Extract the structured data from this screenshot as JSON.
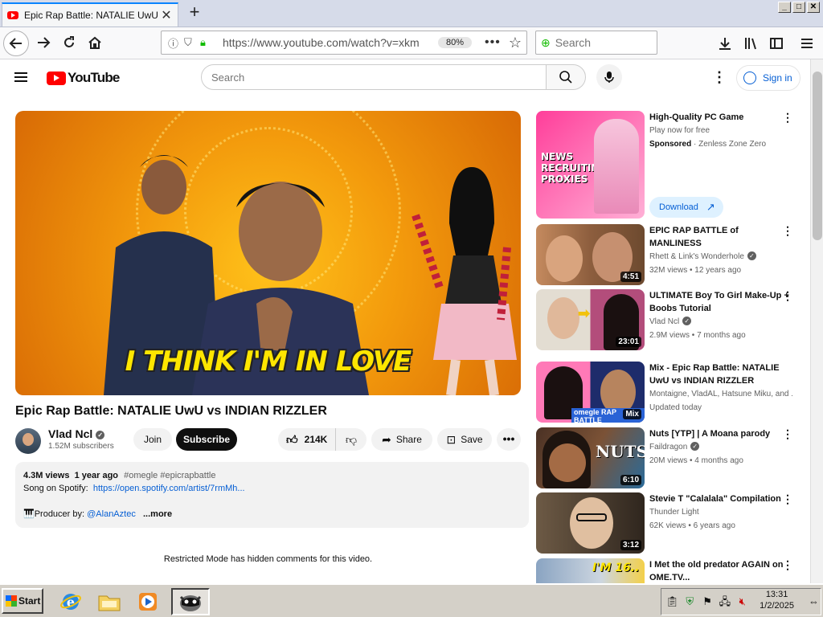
{
  "browser": {
    "tab_title": "Epic Rap Battle: NATALIE UwU vs INDIAN RIZZLER",
    "tab_close": "✕",
    "new_tab": "+",
    "url": "https://www.youtube.com/watch?v=xkm",
    "zoom": "80%",
    "search_placeholder": "Search",
    "window_buttons": [
      "_",
      "□",
      "✕"
    ]
  },
  "youtube": {
    "logo_text": "YouTube",
    "search_placeholder": "Search",
    "sign_in": "Sign in"
  },
  "video": {
    "caption": "I THINK I'M IN LOVE",
    "title": "Epic Rap Battle: NATALIE UwU vs INDIAN RIZZLER",
    "channel": "Vlad Ncl",
    "subscribers": "1.52M subscribers",
    "join": "Join",
    "subscribe": "Subscribe",
    "likes": "214K",
    "share": "Share",
    "save": "Save",
    "views": "4.3M views",
    "age": "1 year ago",
    "tags": "#omegle #epicrapbattle",
    "spotify_label": "Song on Spotify:",
    "spotify_link": "https://open.spotify.com/artist/7rmMh...",
    "producer_label": "🎹Producer by:",
    "producer_link": "@AlanAztec",
    "more": "...more",
    "restricted": "Restricted Mode has hidden comments for this video."
  },
  "sidebar": [
    {
      "title": "High-Quality PC Game",
      "line1": "Play now for free",
      "sponsored": "Sponsored",
      "line2": "· Zenless Zone Zero",
      "download": "Download",
      "thumb_text": "NEWS RECRUITING PROXIES",
      "colors": [
        "#ff3e9a",
        "#f8b6d8"
      ]
    },
    {
      "title": "EPIC RAP BATTLE of MANLINESS",
      "channel": "Rhett & Link's Wonderhole",
      "stats": "32M views • 12 years ago",
      "duration": "4:51",
      "colors": [
        "#c48a5e",
        "#6d4a2f"
      ]
    },
    {
      "title": "ULTIMATE Boy To Girl Make-Up + Boobs Tutorial",
      "channel": "Vlad Ncl",
      "stats": "2.9M views • 7 months ago",
      "duration": "23:01",
      "colors": [
        "#d8d2c8",
        "#b34d7b"
      ]
    },
    {
      "title": "Mix - Epic Rap Battle: NATALIE UwU vs INDIAN RIZZLER",
      "channel": "Montaigne, VladAL, Hatsune Miku, and ...",
      "stats": "Updated today",
      "badge": "Mix",
      "thumb_text": "omegle RAP BATTLE",
      "colors": [
        "#ff79b7",
        "#1e2c6b"
      ]
    },
    {
      "title": "Nuts [YTP] | A Moana parody",
      "channel": "Faildragon",
      "stats": "20M views • 4 months ago",
      "duration": "6:10",
      "thumb_text": "NUTS",
      "colors": [
        "#4a3124",
        "#2a6b9a"
      ]
    },
    {
      "title": "Stevie T \"Calalala\" Compilation",
      "channel": "Thunder Light",
      "stats": "62K views • 6 years ago",
      "duration": "3:12",
      "colors": [
        "#6d5a45",
        "#2f261e"
      ]
    },
    {
      "title": "I Met the old predator AGAIN on OME.TV...",
      "channel": "",
      "stats": "",
      "thumb_text": "I'M 16..",
      "colors": [
        "#8aa4c2",
        "#f3d04a"
      ]
    }
  ],
  "taskbar": {
    "start": "Start",
    "time": "13:31",
    "date": "1/2/2025"
  }
}
